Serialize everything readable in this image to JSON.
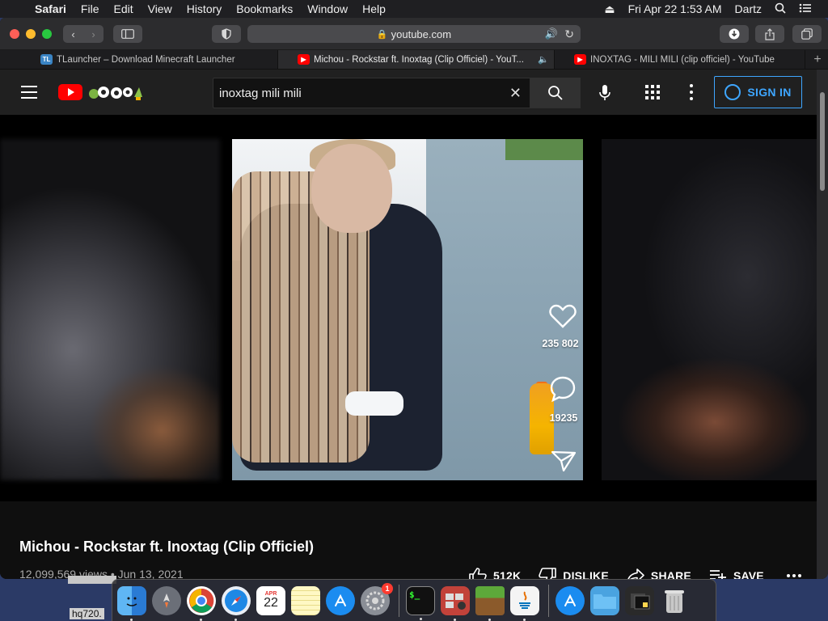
{
  "menubar": {
    "app": "Safari",
    "items": [
      "File",
      "Edit",
      "View",
      "History",
      "Bookmarks",
      "Window",
      "Help"
    ],
    "clock": "Fri Apr 22  1:53 AM",
    "user": "Dartz"
  },
  "browser": {
    "address": "youtube.com",
    "tabs": [
      {
        "label": "TLauncher – Download Minecraft Launcher",
        "favicon": "TL"
      },
      {
        "label": "Michou - Rockstar ft. Inoxtag (Clip Officiel) - YouT...",
        "favicon": "youtube",
        "active": true,
        "audio": true
      },
      {
        "label": "INOXTAG - MILI MILI (clip officiel) - YouTube",
        "favicon": "youtube"
      }
    ]
  },
  "youtube": {
    "search_value": "inoxtag mili mili",
    "sign_in": "SIGN IN",
    "overlay": {
      "likes": "235 802",
      "comments": "19235"
    },
    "video": {
      "title": "Michou - Rockstar ft. Inoxtag (Clip Officiel)",
      "meta": "12,099,569 views • Jun 13, 2021",
      "like_count": "512K",
      "dislike": "DISLIKE",
      "share": "SHARE",
      "save": "SAVE"
    }
  },
  "desktop": {
    "label": "hq720."
  },
  "dock": {
    "calendar_month": "APR",
    "calendar_day": "22",
    "settings_badge": "1",
    "terminal_text": "$_"
  },
  "colors": {
    "yt_red": "#ff0000",
    "signin_blue": "#3ea6ff",
    "yt_bg": "#0f0f0f",
    "masthead": "#202020"
  }
}
